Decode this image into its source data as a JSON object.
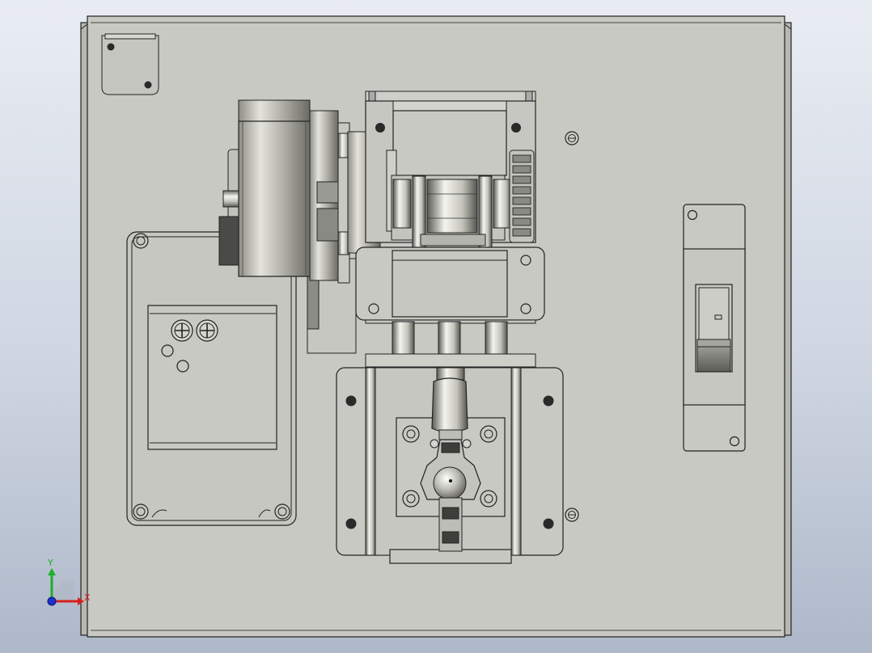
{
  "viewport": {
    "name": "cad-3d-viewport",
    "background_top": "#e9edf3",
    "background_bottom": "#aeb8c9"
  },
  "model": {
    "panel_color": "#c9c9c3",
    "edge_color": "#1e1e1e",
    "metal_light": "#f2f2ec",
    "metal_dark": "#5e5e58"
  },
  "triad": {
    "x_label": "X",
    "y_label": "Y",
    "x_color": "#d81e1e",
    "y_color": "#1fae2a",
    "z_color": "#1b2fd6"
  }
}
